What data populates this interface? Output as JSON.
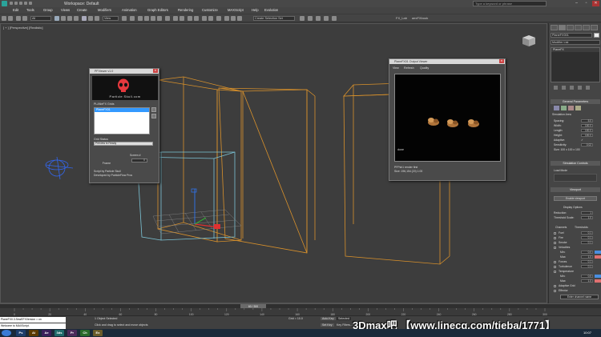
{
  "titlebar": {
    "title": "Workspace: Default",
    "search_placeholder": "Type a keyword or phrase"
  },
  "menu": [
    "Edit",
    "Tools",
    "Group",
    "Views",
    "Create",
    "Modifiers",
    "Animation",
    "Graph Editors",
    "Rendering",
    "Customize",
    "MAXScript",
    "Help",
    "Evolution"
  ],
  "toolbar": {
    "filter_select": "All",
    "view_select": "View",
    "selection_set": "Create Selection Set",
    "fx_label": "FX_Lab",
    "ae_label": "aexFXbook"
  },
  "viewport": {
    "label": "[ + ] [Perspective] [Realistic]"
  },
  "pf_viewer": {
    "title": "PFViewer v1.0",
    "brand": "Particle Skull.com",
    "list_label": "PLANeFX Grids",
    "list_items": [
      "PlaneFX01"
    ],
    "grid_label": "Grid Status",
    "grid_value": "Preview is Ready",
    "frame_button": "Frame",
    "screen_label": "Screen #",
    "screen_value": "0",
    "credits": [
      "Script by Particle Skull",
      "Developed by ParticleFlow Pros"
    ]
  },
  "output_viewer": {
    "title": "PlaneFX01 Output Viewer",
    "menu": [
      "View",
      "Refresh",
      "Quality"
    ],
    "canvas_label": "done",
    "info": [
      "PFPsh1 render first",
      "Size: 196,154 (20) 1:00"
    ]
  },
  "command_panel": {
    "object_name": "PlaneFX001",
    "modifier_list": "Modifier List",
    "stack_items": [
      "PlaneFX"
    ],
    "general_header": "General Parameters",
    "sim_area_label": "Simulation Area",
    "params": [
      {
        "label": "Spacing:",
        "value": "5.0"
      },
      {
        "label": "Width:",
        "value": "100.0"
      },
      {
        "label": "Length:",
        "value": "100.0"
      },
      {
        "label": "Height:",
        "value": "100.0"
      },
      {
        "label": "Adaptive:",
        "value": "✓"
      },
      {
        "label": "Sensitivity:",
        "value": "0.02"
      },
      {
        "label": "Size: 100 x 100 x 100",
        "value": ""
      }
    ],
    "sim_controls_header": "Simulation Controls",
    "load_mode_label": "Load Mode",
    "viewport_header": "Viewport",
    "display_button": "Enable viewport",
    "display_options": "Display Options",
    "display_params": [
      {
        "label": "Reduction:",
        "value": "1"
      },
      {
        "label": "Threshold Scale:",
        "value": "1.0"
      }
    ],
    "channels_header": "Channels",
    "thresholds_header": "Thresholds",
    "channels": [
      {
        "label": "Fuel",
        "value": "0.1"
      },
      {
        "label": "Fire",
        "value": "0.1"
      },
      {
        "label": "Smoke",
        "value": "0.1"
      },
      {
        "label": "Velocities",
        "value": ""
      },
      {
        "label": "Min:",
        "value": "0.0"
      },
      {
        "label": "Max:",
        "value": "1.0"
      },
      {
        "label": "Forces",
        "value": "0.1"
      },
      {
        "label": "Turbulence",
        "value": "0.1"
      },
      {
        "label": "Temperature",
        "value": ""
      },
      {
        "label": "Min:",
        "value": "0.0"
      },
      {
        "label": "Max:",
        "value": "1.0"
      },
      {
        "label": "Adaptive Grid",
        "value": ""
      },
      {
        "label": "Effector",
        "value": ""
      }
    ],
    "channel_name_button": "Enter channel name"
  },
  "timeline": {
    "frame_readout": "60 / 300",
    "tick_labels": [
      "0",
      "20",
      "40",
      "60",
      "80",
      "100",
      "120",
      "140",
      "160",
      "180",
      "200",
      "220",
      "240",
      "260",
      "280",
      "300"
    ]
  },
  "status": {
    "maxscript": "PlaneFX0.3.SewEFXVersion = on",
    "listener": "Welcome to MAXScript.",
    "selected": "1 Object Selected",
    "hint": "Click and drag to select and move objects",
    "grid": "Grid = 10.0",
    "key": "Auto Key",
    "selected_btn": "Selected",
    "set_key": "Set Key",
    "key_filters": "Key Filters...",
    "clock": "10:07"
  },
  "taskbar_items": [
    "Ps",
    "Ai",
    "Ae",
    "3ds",
    "Pr",
    "Ch",
    "Ex"
  ],
  "watermark": "3Dmax吧 【www.linecg.com/tieba/1771】",
  "colors": {
    "skull": "#e8393e",
    "axis_x": "#e03030",
    "axis_y": "#30c030",
    "axis_z": "#3070e0",
    "bbox_orange": "#d9912b",
    "bbox_cyan": "#7cc4d6",
    "helper_blue": "#3366ee"
  }
}
